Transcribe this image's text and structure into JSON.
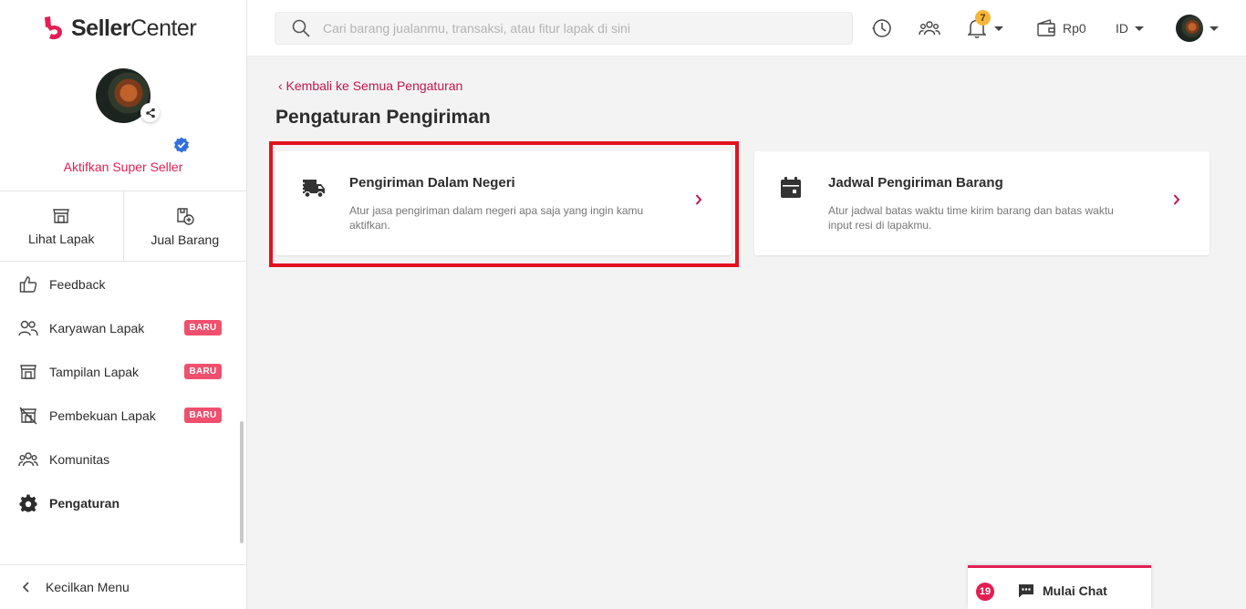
{
  "brand": {
    "part1": "Seller",
    "part2": "Center"
  },
  "profile": {
    "super_seller_label": "Aktifkan Super Seller"
  },
  "quick_actions": {
    "view_store": "Lihat Lapak",
    "sell_item": "Jual Barang"
  },
  "menu": {
    "items": [
      {
        "label": "Feedback"
      },
      {
        "label": "Karyawan Lapak",
        "badge": "BARU"
      },
      {
        "label": "Tampilan Lapak",
        "badge": "BARU"
      },
      {
        "label": "Pembekuan Lapak",
        "badge": "BARU"
      },
      {
        "label": "Komunitas"
      },
      {
        "label": "Pengaturan"
      }
    ],
    "collapse_label": "Kecilkan Menu"
  },
  "header": {
    "search_placeholder": "Cari barang jualanmu, transaksi, atau fitur lapak di sini",
    "notification_count": "7",
    "balance": "Rp0",
    "language": "ID"
  },
  "main": {
    "back_link": "‹ Kembali ke Semua Pengaturan",
    "title": "Pengaturan Pengiriman",
    "cards": [
      {
        "title": "Pengiriman Dalam Negeri",
        "description": "Atur jasa pengiriman dalam negeri apa saja yang ingin kamu aktifkan."
      },
      {
        "title": "Jadwal Pengiriman Barang",
        "description": "Atur jadwal batas waktu time kirim barang dan batas waktu input resi di lapakmu."
      }
    ]
  },
  "chat": {
    "unread_count": "19",
    "label": "Mulai Chat"
  },
  "colors": {
    "brand_red": "#e31e52",
    "highlight_red": "#e3111f",
    "badge_pink": "#f0506e",
    "notif_yellow": "#f5b73b",
    "verified_blue": "#2f6fe0"
  }
}
